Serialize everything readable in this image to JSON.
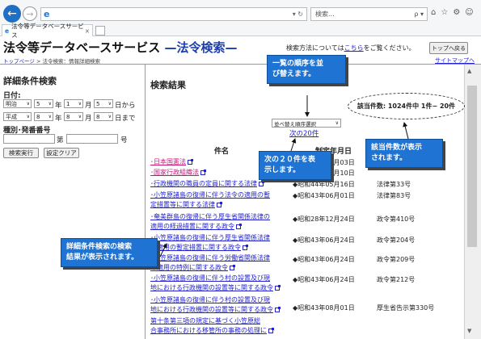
{
  "browser": {
    "address_icon": "e",
    "address_tail": "▾ ↻",
    "search_placeholder": "検索...",
    "search_tail": "ρ ▾",
    "toolbar_icons": [
      "home-icon",
      "star-icon",
      "gear-icon",
      "smiley-icon"
    ],
    "toolbar_glyphs": [
      "⌂",
      "☆",
      "⚙",
      "☺"
    ],
    "tab_label": "法令等データベースサービス",
    "tab_close": "×"
  },
  "header": {
    "title": "法令等データベースサービス",
    "subtitle": " —法令検索—",
    "breadcrumb_home": "トップページ",
    "breadcrumb_rest": " > 法令検索：情報詳細検索",
    "help_prefix": "検索方法については",
    "help_link": "こちら",
    "help_suffix": "をご覧ください。",
    "top_button": "トップへ戻る",
    "sitemap": "サイトマップへ"
  },
  "left": {
    "title": "詳細条件検索",
    "date_label": "日付:",
    "row1": {
      "era": "明治",
      "year": "5",
      "month": "1",
      "day": "5",
      "unit_y": "年",
      "unit_m": "月",
      "unit_d": "日から"
    },
    "row2": {
      "era": "平成",
      "year": "8",
      "month": "8",
      "day": "8",
      "unit_y": "年",
      "unit_m": "月",
      "unit_d": "日まで"
    },
    "type_label": "種別･発番番号",
    "dai": "第",
    "go": "号",
    "search_btn": "検索実行",
    "clear_btn": "設定クリア"
  },
  "main": {
    "results_title": "検索結果",
    "sort_select": "並べ替え順序選択",
    "next20": "次の20件",
    "col_name": "件名",
    "col_date": "制定年月日",
    "count_text": "該当件数: 1024件中 1件− 20件",
    "rows": [
      {
        "t1": "･日本国憲法",
        "t2": "",
        "date": "◆昭和21年11月03日",
        "no": "",
        "pink": true
      },
      {
        "t1": "･国家行政組織法",
        "t2": "",
        "date": "◆昭和23年07月10日",
        "no": "",
        "pink": true
      },
      {
        "t1": "･行政機関の職員の定員に関する法律",
        "t2": "",
        "date": "◆昭和44年05月16日",
        "no": "法律第33号",
        "pink": false
      },
      {
        "t1": "･小笠原諸島の復帰に伴う法令の適用の暫",
        "t2": "定措置等に関する法律",
        "date": "◆昭和43年06月01日",
        "no": "法律第83号",
        "pink": false
      },
      {
        "t1": "･奄美群島の復帰に伴う厚生省関係法律の",
        "t2": "適用の経過措置に関する政令",
        "date": "◆昭和28年12月24日",
        "no": "政令第410号",
        "pink": false
      },
      {
        "t1": "･小笠原諸島の復帰に伴う厚生省関係法律",
        "t2": "の適用の暫定措置に関する政令",
        "date": "◆昭和43年06月24日",
        "no": "政令第204号",
        "pink": false
      },
      {
        "t1": "･小笠原諸島の復帰に伴う労働省関係法律",
        "t2": "の適用の特例に関する政令",
        "date": "◆昭和43年06月24日",
        "no": "政令第209号",
        "pink": false
      },
      {
        "t1": "･小笠原諸島の復帰に伴う村の設置及び現",
        "t2": "地における行政機関の設置等に関する政令",
        "date": "◆昭和43年06月24日",
        "no": "政令第212号",
        "pink": false
      },
      {
        "t1": "･小笠原諸島の復帰に伴う村の設置及び現",
        "t2": "地における行政機関の設置等に関する政令",
        "date": "◆昭和43年08月01日",
        "no": "厚生省告示第330号",
        "pink": false
      },
      {
        "t1": "第十条第三項の規定に基づく小笠原総",
        "t2": "合事務所における移管所の事務の処理に",
        "date": "",
        "no": "",
        "pink": false
      }
    ]
  },
  "callouts": {
    "sort": [
      "一覧の順序を並",
      "び替えます。"
    ],
    "next": [
      "次の２０件を表",
      "示します。"
    ],
    "count": [
      "該当件数が表示",
      "されます。"
    ],
    "results": [
      "詳細条件検索の検索",
      "結果が表示されます。"
    ]
  }
}
